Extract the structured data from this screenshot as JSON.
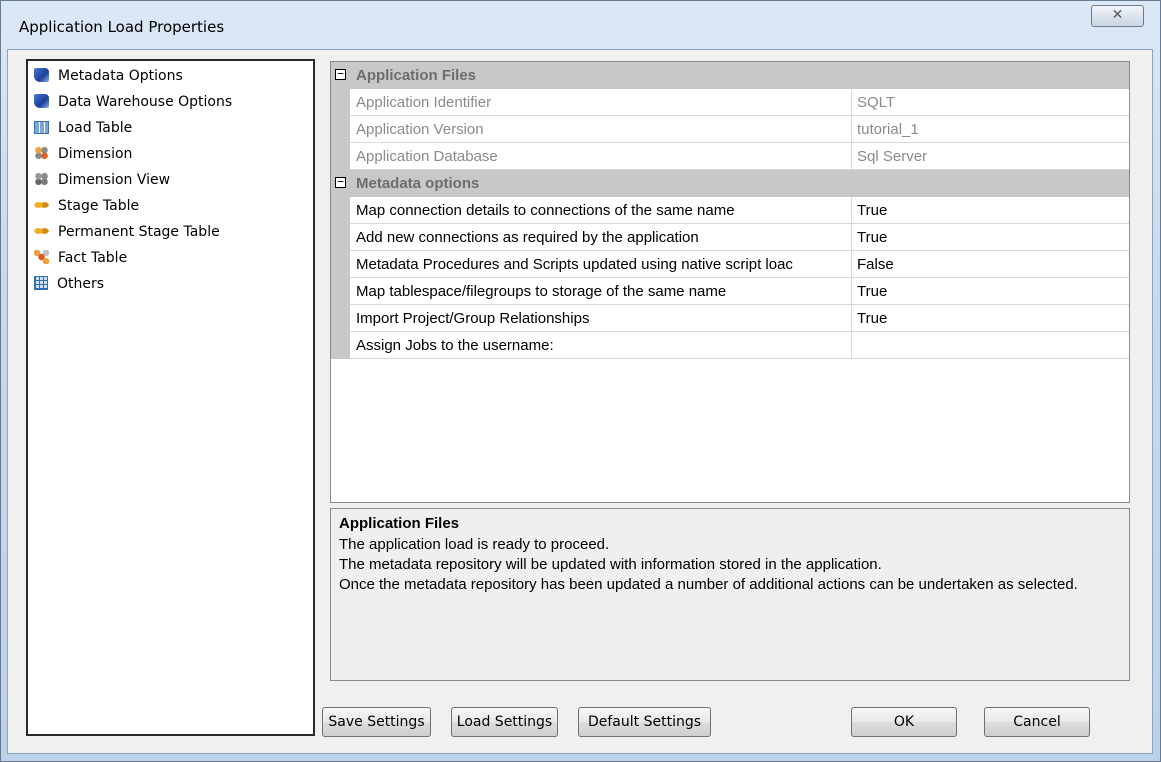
{
  "window": {
    "title": "Application Load Properties",
    "close_glyph": "✕"
  },
  "tree": {
    "items": [
      {
        "label": "Metadata Options",
        "icon": "metadata-book-icon"
      },
      {
        "label": "Data Warehouse Options",
        "icon": "warehouse-book-icon"
      },
      {
        "label": "Load Table",
        "icon": "load-table-icon"
      },
      {
        "label": "Dimension",
        "icon": "dimension-icon"
      },
      {
        "label": "Dimension View",
        "icon": "dimension-view-icon"
      },
      {
        "label": "Stage Table",
        "icon": "stage-table-icon"
      },
      {
        "label": "Permanent Stage Table",
        "icon": "permanent-stage-table-icon"
      },
      {
        "label": "Fact Table",
        "icon": "fact-table-icon"
      },
      {
        "label": "Others",
        "icon": "others-grid-icon"
      }
    ]
  },
  "grid": {
    "categories": [
      {
        "label": "Application Files",
        "toggle": "−",
        "rows": [
          {
            "name": "Application Identifier",
            "value": "SQLT"
          },
          {
            "name": "Application Version",
            "value": "tutorial_1"
          },
          {
            "name": "Application Database",
            "value": "Sql Server"
          }
        ]
      },
      {
        "label": "Metadata options",
        "toggle": "−",
        "rows": [
          {
            "name": "Map connection details to connections of the same name",
            "value": "True"
          },
          {
            "name": "Add new connections as required by the application",
            "value": "True"
          },
          {
            "name": "Metadata Procedures and Scripts updated using native script loac",
            "value": "False"
          },
          {
            "name": "Map tablespace/filegroups to storage of the same name",
            "value": "True"
          },
          {
            "name": "Import Project/Group Relationships",
            "value": "True"
          },
          {
            "name": "Assign Jobs to the username:",
            "value": ""
          }
        ]
      }
    ]
  },
  "description": {
    "title": "Application Files",
    "lines": [
      "The application load is ready to proceed.",
      "The metadata repository will be updated with information stored in the application.",
      "Once the metadata repository has been updated a number of additional actions can be undertaken as selected."
    ]
  },
  "buttons": {
    "save": "Save Settings",
    "load": "Load Settings",
    "default": "Default Settings",
    "ok": "OK",
    "cancel": "Cancel"
  }
}
